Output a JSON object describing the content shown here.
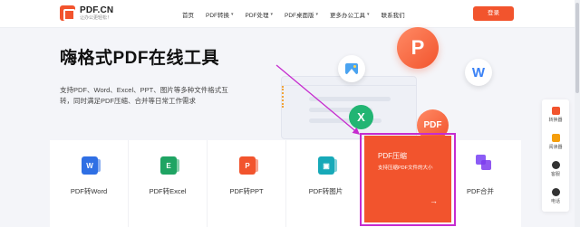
{
  "header": {
    "logo": {
      "name": "PDF.CN",
      "slogan": "让办公更轻松！"
    },
    "nav": [
      {
        "label": "首页",
        "has_dropdown": false
      },
      {
        "label": "PDF转换",
        "has_dropdown": true
      },
      {
        "label": "PDF处理",
        "has_dropdown": true
      },
      {
        "label": "PDF桌面版",
        "has_dropdown": true
      },
      {
        "label": "更多办公工具",
        "has_dropdown": true
      },
      {
        "label": "联系我们",
        "has_dropdown": false
      }
    ],
    "login_label": "登录"
  },
  "hero": {
    "title": "嗨格式PDF在线工具",
    "desc": "支持PDF、Word、Excel、PPT、图片等多种文件格式互转，同时满足PDF压缩、合并等日常工作需求"
  },
  "illustration": {
    "p_letter": "P",
    "w_letter": "W",
    "x_letter": "X",
    "pdf_label": "PDF"
  },
  "tools": [
    {
      "label": "PDF转Word",
      "icon": "word-icon",
      "color": "#2f6fe4",
      "letter": "W"
    },
    {
      "label": "PDF转Excel",
      "icon": "excel-icon",
      "color": "#1fa463",
      "letter": "E"
    },
    {
      "label": "PDF转PPT",
      "icon": "ppt-icon",
      "color": "#f2542d",
      "letter": "P"
    },
    {
      "label": "PDF转图片",
      "icon": "image-icon",
      "color": "#17a9b8",
      "letter": "▣"
    }
  ],
  "featured_tool": {
    "title": "PDF压缩",
    "desc": "支持压缩PDF文件的大小",
    "arrow": "→"
  },
  "merge_tool": {
    "label": "PDF合并",
    "icon": "merge-icon"
  },
  "float_bar": [
    {
      "label": "转换器",
      "icon": "converter-icon",
      "color": "#f2542d"
    },
    {
      "label": "阅读器",
      "icon": "reader-icon",
      "color": "#f59e0b"
    },
    {
      "label": "客服",
      "icon": "service-icon",
      "color": "#333333"
    },
    {
      "label": "电话",
      "icon": "phone-icon",
      "color": "#333333"
    }
  ],
  "colors": {
    "brand": "#f2542d",
    "highlight": "#c62ccf"
  }
}
